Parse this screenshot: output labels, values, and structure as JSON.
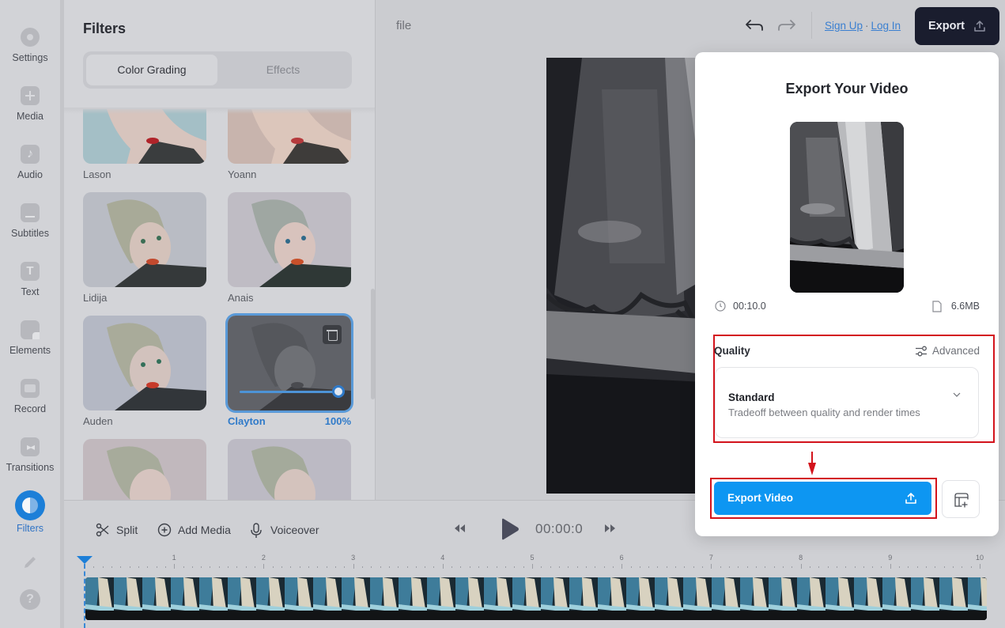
{
  "sidebar": {
    "items": [
      {
        "label": "Settings",
        "icon": "settings-icon"
      },
      {
        "label": "Media",
        "icon": "plus-icon"
      },
      {
        "label": "Audio",
        "icon": "music-note-icon"
      },
      {
        "label": "Subtitles",
        "icon": "subtitles-icon"
      },
      {
        "label": "Text",
        "icon": "text-icon"
      },
      {
        "label": "Elements",
        "icon": "elements-icon"
      },
      {
        "label": "Record",
        "icon": "camera-icon"
      },
      {
        "label": "Transitions",
        "icon": "transitions-icon"
      },
      {
        "label": "Filters",
        "icon": "filters-icon",
        "active": true
      }
    ],
    "help_glyph": "?"
  },
  "filters_panel": {
    "title": "Filters",
    "tabs": [
      {
        "label": "Color Grading",
        "active": true
      },
      {
        "label": "Effects",
        "active": false
      }
    ],
    "filters": [
      {
        "name": "Lason"
      },
      {
        "name": "Yoann"
      },
      {
        "name": "Lidija"
      },
      {
        "name": "Anais"
      },
      {
        "name": "Auden"
      },
      {
        "name": "Clayton",
        "selected": true,
        "intensity": "100%",
        "intensity_value": 1.0
      }
    ]
  },
  "topbar": {
    "filename": "file",
    "sign_up": "Sign Up",
    "separator": "·",
    "log_in": "Log In",
    "export_label": "Export"
  },
  "playback": {
    "split_label": "Split",
    "add_media_label": "Add Media",
    "voiceover_label": "Voiceover",
    "time": "00:00:0"
  },
  "timeline": {
    "ruler_labels": [
      "1",
      "2",
      "3",
      "4",
      "5",
      "6",
      "7",
      "8",
      "9",
      "10"
    ],
    "duration_seconds": 10,
    "playhead_seconds": 0
  },
  "export_modal": {
    "title": "Export Your Video",
    "duration": "00:10.0",
    "file_size": "6.6MB",
    "quality_label": "Quality",
    "advanced_label": "Advanced",
    "quality_selected": "Standard",
    "quality_description": "Tradeoff between quality and render times",
    "export_button": "Export Video"
  },
  "colors": {
    "accent": "#0d96f2",
    "active_blue": "#1c7fd8",
    "highlight_red": "#d3131c",
    "export_dark": "#1a1d2e"
  }
}
